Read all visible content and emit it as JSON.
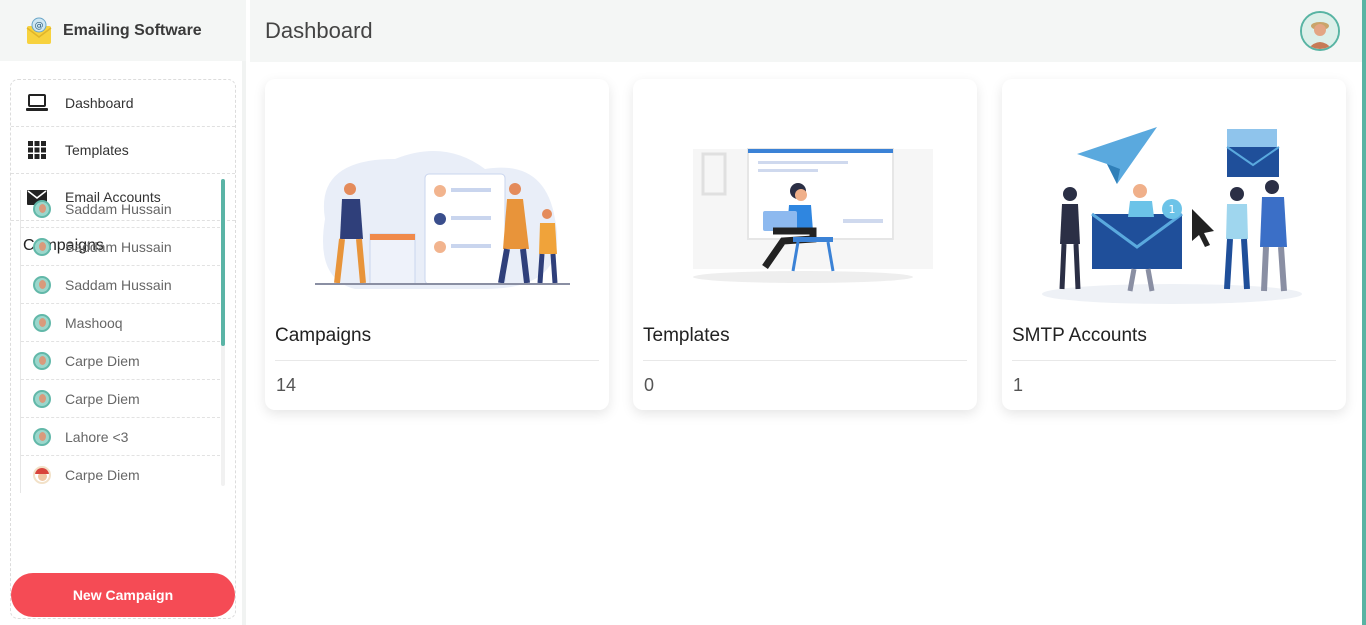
{
  "brand": {
    "title": "Emailing Software",
    "logo_icon": "envelope-at-icon"
  },
  "header": {
    "title": "Dashboard",
    "avatar_icon": "user-avatar-icon"
  },
  "sidebar": {
    "menu": [
      {
        "label": "Dashboard",
        "icon": "laptop-icon"
      },
      {
        "label": "Templates",
        "icon": "grid-icon"
      },
      {
        "label": "Email Accounts",
        "icon": "envelope-icon"
      }
    ],
    "campaigns_heading": "Campaigns",
    "campaigns": [
      "Saddam Hussain",
      "Saddam Hussain",
      "Saddam Hussain",
      "Mashooq",
      "Carpe Diem",
      "Carpe Diem",
      "Lahore <3",
      "Carpe Diem"
    ],
    "new_button": "New Campaign"
  },
  "cards": [
    {
      "title": "Campaigns",
      "value": "14"
    },
    {
      "title": "Templates",
      "value": "0"
    },
    {
      "title": "SMTP Accounts",
      "value": "1"
    }
  ],
  "colors": {
    "accent": "#58b4a3",
    "button": "#f54b55",
    "header_bg": "#f4f6f5"
  }
}
